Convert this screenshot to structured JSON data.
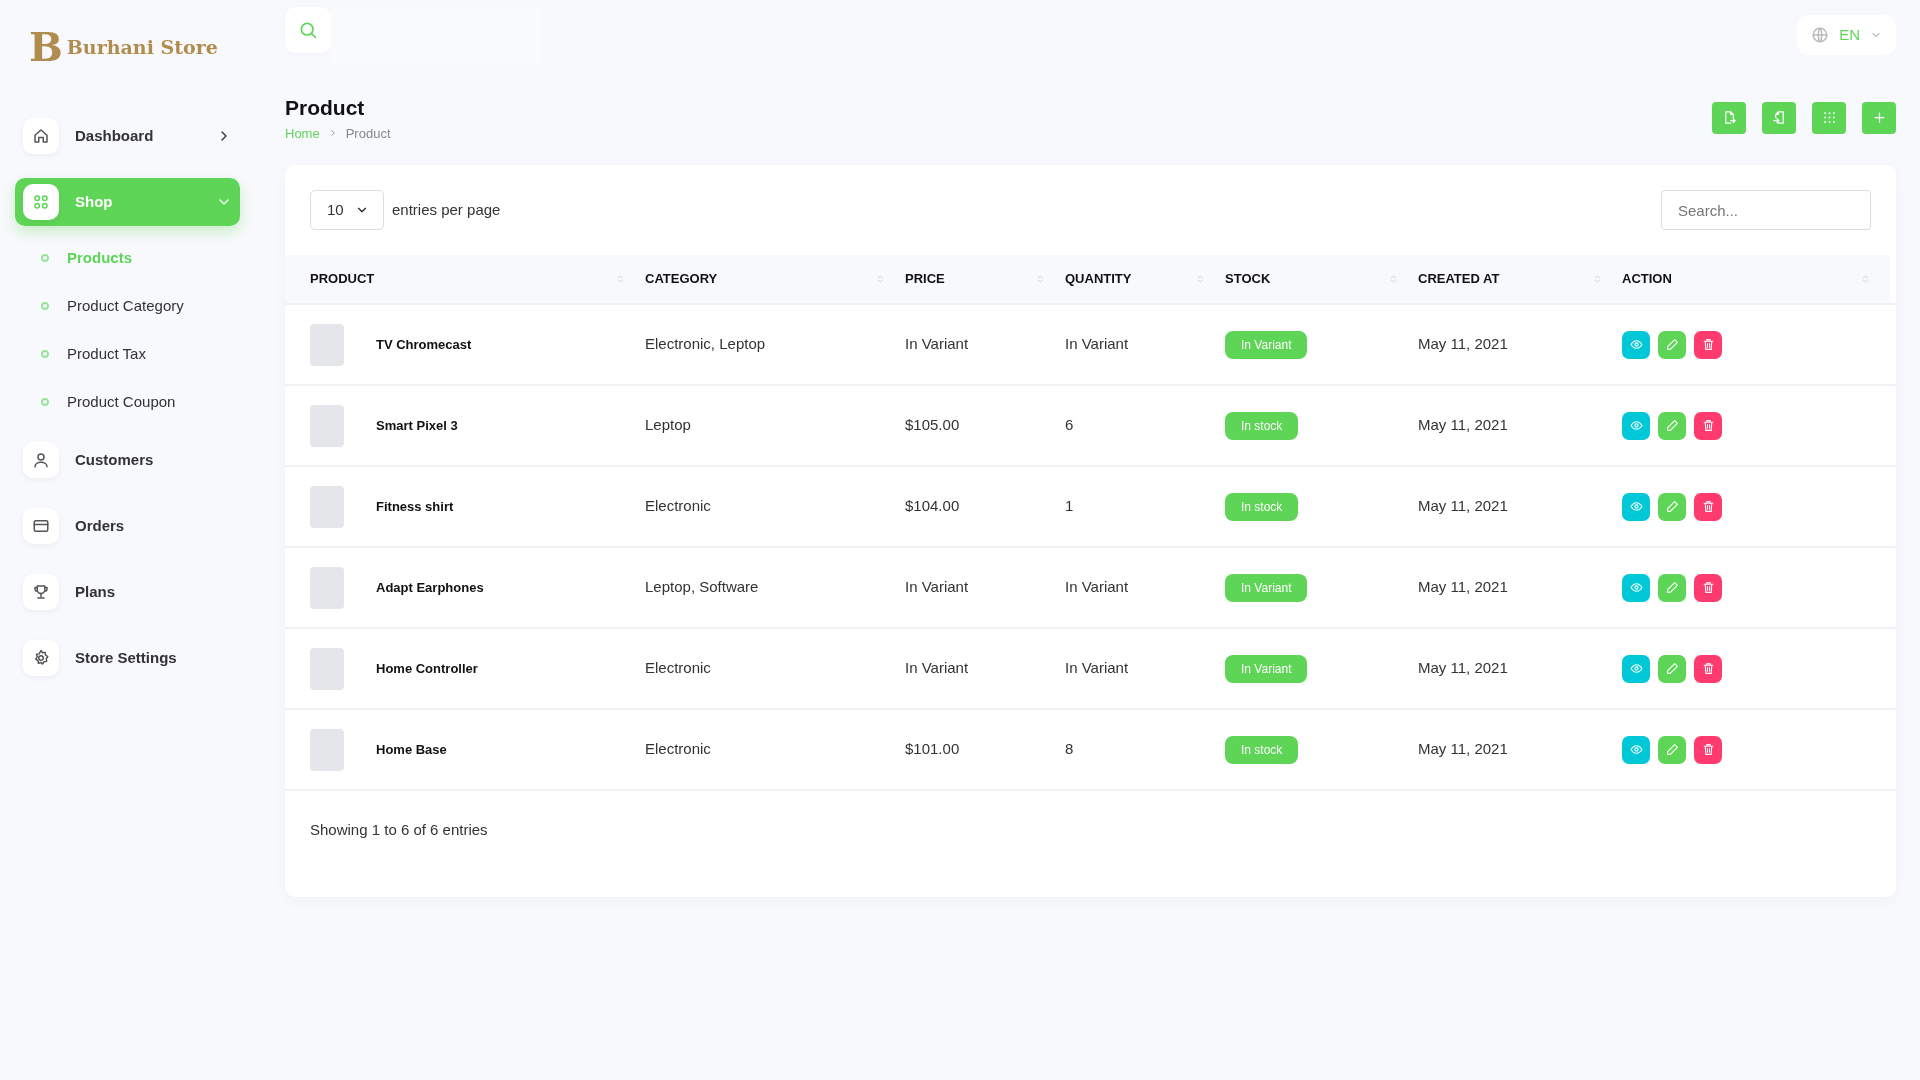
{
  "brand": {
    "name": "Burhani Store",
    "monogram": "B"
  },
  "language": {
    "label": "EN"
  },
  "sidebar": {
    "items": [
      {
        "label": "Dashboard",
        "kind": "group",
        "selected": false,
        "expanded": false
      },
      {
        "label": "Shop",
        "kind": "group",
        "selected": true,
        "expanded": true,
        "children": [
          {
            "label": "Products",
            "selected": true
          },
          {
            "label": "Product Category",
            "selected": false
          },
          {
            "label": "Product Tax",
            "selected": false
          },
          {
            "label": "Product Coupon",
            "selected": false
          }
        ]
      },
      {
        "label": "Customers",
        "kind": "link",
        "selected": false
      },
      {
        "label": "Orders",
        "kind": "link",
        "selected": false
      },
      {
        "label": "Plans",
        "kind": "link",
        "selected": false
      },
      {
        "label": "Store Settings",
        "kind": "link",
        "selected": false
      }
    ]
  },
  "page": {
    "title": "Product",
    "breadcrumb": [
      "Home",
      "Product"
    ]
  },
  "table": {
    "page_size": "10",
    "page_size_label": "entries per page",
    "search_placeholder": "Search...",
    "columns": [
      "PRODUCT",
      "CATEGORY",
      "PRICE",
      "QUANTITY",
      "STOCK",
      "CREATED AT",
      "ACTION"
    ],
    "rows": [
      {
        "product": "TV Chromecast",
        "category": "Electronic, Leptop",
        "price": "In Variant",
        "quantity": "In Variant",
        "stock": "In Variant",
        "created_at": "May 11, 2021"
      },
      {
        "product": "Smart Pixel 3",
        "category": "Leptop",
        "price": "$105.00",
        "quantity": "6",
        "stock": "In stock",
        "created_at": "May 11, 2021"
      },
      {
        "product": "Fitness shirt",
        "category": "Electronic",
        "price": "$104.00",
        "quantity": "1",
        "stock": "In stock",
        "created_at": "May 11, 2021"
      },
      {
        "product": "Adapt Earphones",
        "category": "Leptop, Software",
        "price": "In Variant",
        "quantity": "In Variant",
        "stock": "In Variant",
        "created_at": "May 11, 2021"
      },
      {
        "product": "Home Controller",
        "category": "Electronic",
        "price": "In Variant",
        "quantity": "In Variant",
        "stock": "In Variant",
        "created_at": "May 11, 2021"
      },
      {
        "product": "Home Base",
        "category": "Electronic",
        "price": "$101.00",
        "quantity": "8",
        "stock": "In stock",
        "created_at": "May 11, 2021"
      }
    ],
    "footer": "Showing 1 to 6 of 6 entries"
  }
}
